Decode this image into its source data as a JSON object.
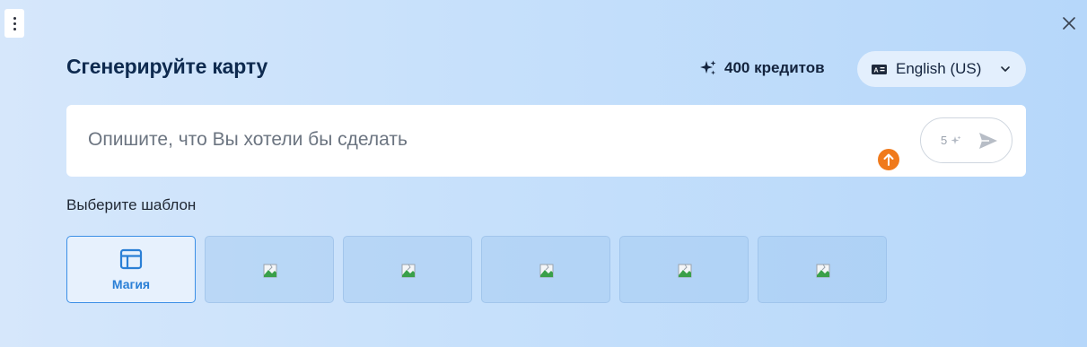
{
  "page": {
    "title": "Сгенерируйте карту",
    "close_icon": "close-icon",
    "menu_icon": "vertical-dots-icon"
  },
  "credits": {
    "label": "400 кредитов",
    "icon": "sparkle-icon"
  },
  "language": {
    "selected": "English (US)",
    "icon": "language-icon",
    "chevron": "chevron-down-icon"
  },
  "prompt": {
    "placeholder": "Опишите, что Вы хотели бы сделать",
    "value": "",
    "cost": "5",
    "upload_icon": "arrow-up-icon",
    "send_icon": "send-icon"
  },
  "templates": {
    "label": "Выберите шаблон",
    "items": [
      {
        "label": "Магия",
        "icon": "layout-icon",
        "active": true
      },
      {
        "label": "",
        "icon": "broken-image-icon",
        "active": false
      },
      {
        "label": "",
        "icon": "broken-image-icon",
        "active": false
      },
      {
        "label": "",
        "icon": "broken-image-icon",
        "active": false
      },
      {
        "label": "",
        "icon": "broken-image-icon",
        "active": false
      },
      {
        "label": "",
        "icon": "broken-image-icon",
        "active": false
      }
    ]
  },
  "colors": {
    "accent": "#3b8fe6",
    "title": "#0e2a4f",
    "upload_badge": "#f07a1c"
  }
}
